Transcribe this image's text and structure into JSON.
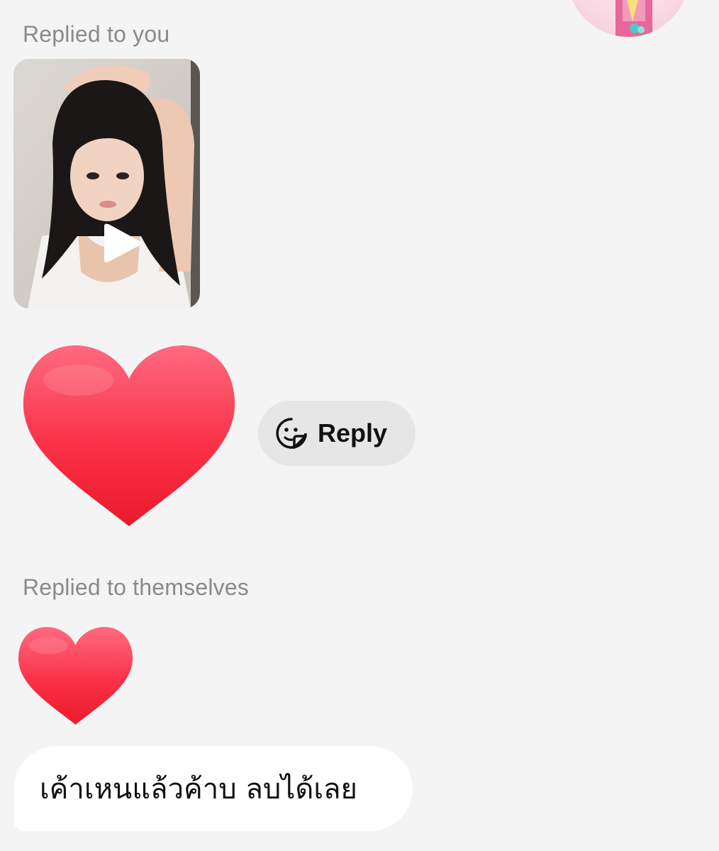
{
  "conversation": {
    "first_reply_caption": "Replied to you",
    "second_reply_caption": "Replied to themselves",
    "quick_reply_label": "Reply",
    "message_text": "เค้าเหนแล้วค้าบ ลบได้เลย"
  },
  "icons": {
    "play": "play-icon",
    "reply": "sticker-face-icon",
    "reaction": "red-heart-emoji"
  },
  "colors": {
    "background": "#f4f4f4",
    "heart_top": "#ff5a74",
    "heart_bottom": "#ee1f33",
    "reply_pill": "#e6e6e6",
    "caption": "#8a8a8a",
    "bubble": "#ffffff"
  }
}
